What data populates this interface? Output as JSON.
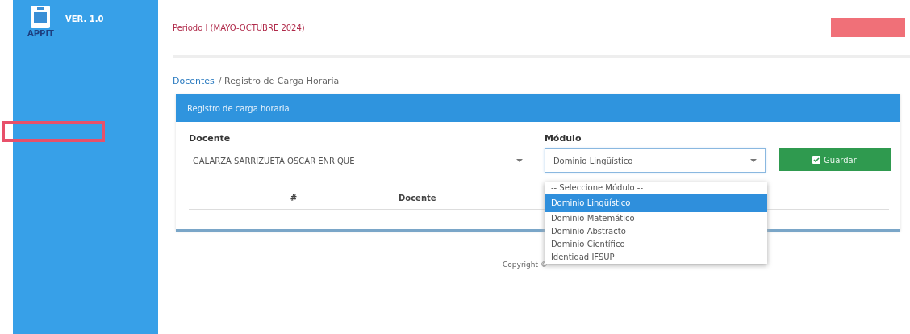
{
  "sidebar": {
    "logo_text": "APPIT",
    "version": "VER. 1.0"
  },
  "header": {
    "period": "Periodo I (MAYO-OCTUBRE 2024)"
  },
  "breadcrumb": {
    "link": "Docentes",
    "current": "/ Registro de Carga Horaria"
  },
  "panel": {
    "title": "Registro de carga horaria",
    "docente": {
      "label": "Docente",
      "value": "GALARZA SARRIZUETA OSCAR ENRIQUE"
    },
    "modulo": {
      "label": "Módulo",
      "value": "Dominio Lingüístico",
      "expanded": true,
      "options": [
        {
          "label": "-- Seleccione Módulo --",
          "selected": false
        },
        {
          "label": "Dominio Lingüístico",
          "selected": true
        },
        {
          "label": "Dominio Matemático",
          "selected": false
        },
        {
          "label": "Dominio Abstracto",
          "selected": false
        },
        {
          "label": "Dominio Científico",
          "selected": false
        },
        {
          "label": "Identidad IFSUP",
          "selected": false
        }
      ]
    },
    "button": "Guardar",
    "table": {
      "columns": [
        "#",
        "Docente"
      ]
    }
  },
  "footer": {
    "text": "Copyright © "
  }
}
